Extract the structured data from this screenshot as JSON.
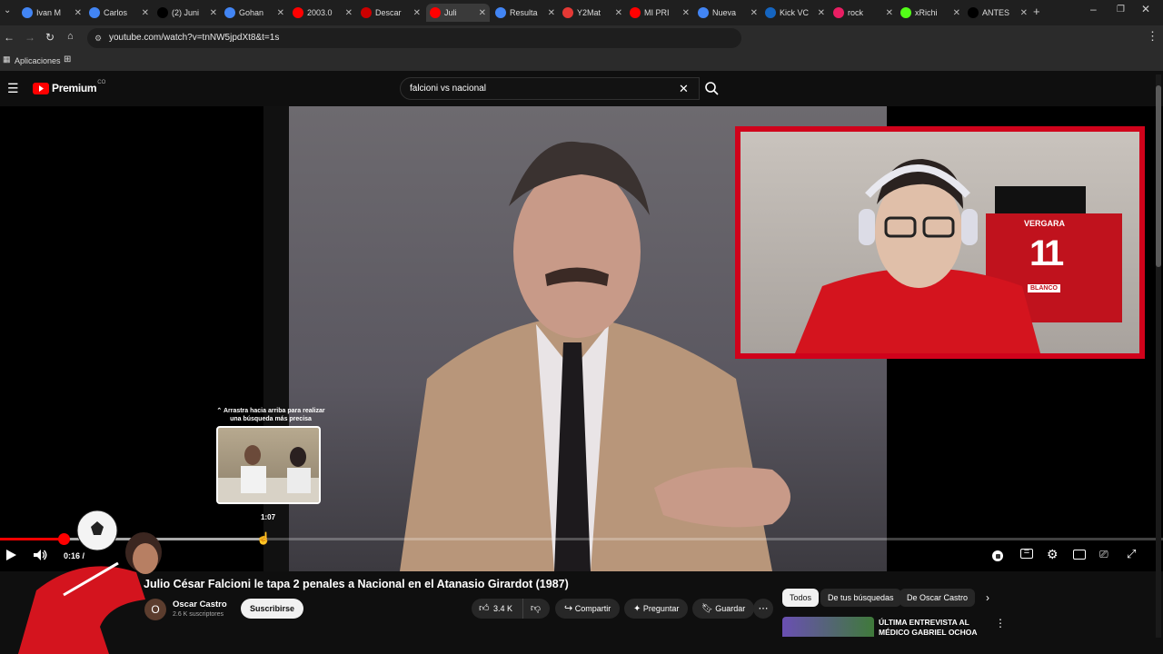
{
  "browser": {
    "tabs": [
      {
        "label": "Ivan M",
        "color": "#4285f4"
      },
      {
        "label": "Carlos",
        "color": "#4285f4"
      },
      {
        "label": "(2) Juni",
        "color": "#000000"
      },
      {
        "label": "Gohan",
        "color": "#4285f4"
      },
      {
        "label": "2003.0",
        "color": "#ff0000"
      },
      {
        "label": "Descar",
        "color": "#cc0000"
      },
      {
        "label": "Juli",
        "color": "#ff0000"
      },
      {
        "label": "Resulta",
        "color": "#4285f4"
      },
      {
        "label": "Y2Mat",
        "color": "#e53935"
      },
      {
        "label": "MI PRI",
        "color": "#ff0000"
      },
      {
        "label": "Nueva",
        "color": "#4285f4"
      },
      {
        "label": "Kick VC",
        "color": "#1565c0"
      },
      {
        "label": "rock",
        "color": "#e91e63"
      },
      {
        "label": "xRichi",
        "color": "#53fc18"
      },
      {
        "label": "ANTES",
        "color": "#000000"
      }
    ],
    "url": "youtube.com/watch?v=tnNW5jpdXt8&t=1s",
    "bookmark": "Aplicaciones"
  },
  "youtube": {
    "logo_text": "Premium",
    "logo_badge": "CO",
    "search_query": "falcioni vs nacional"
  },
  "player": {
    "current_time": "0:16 /",
    "hover_time": "1:07",
    "hint_line1": "Arrastra hacia arriba para realizar",
    "hint_line2": "una búsqueda más precisa",
    "progress_played": 0.055,
    "progress_hover": 0.23
  },
  "webcam": {
    "jersey_name": "VERGARA",
    "jersey_number": "11",
    "jersey_sponsor": "BLANCO"
  },
  "video_info": {
    "title": "Julio César Falcioni le tapa 2 penales a Nacional en el Atanasio Girardot (1987)",
    "channel_initial": "O",
    "channel_name": "Oscar Castro",
    "subscribers": "2.6 K suscriptores",
    "subscribe_label": "Suscribirse",
    "likes": "3.4 K",
    "share_label": "Compartir",
    "ask_label": "Preguntar",
    "save_label": "Guardar"
  },
  "recommendations": {
    "chips": [
      "Todos",
      "De tus búsquedas",
      "De Oscar Castro"
    ],
    "first_title_line1": "ÚLTIMA ENTREVISTA AL",
    "first_title_line2": "MÉDICO GABRIEL OCHOA"
  },
  "colors": {
    "accent": "#ff0000",
    "webcam_border": "#d0021b"
  }
}
